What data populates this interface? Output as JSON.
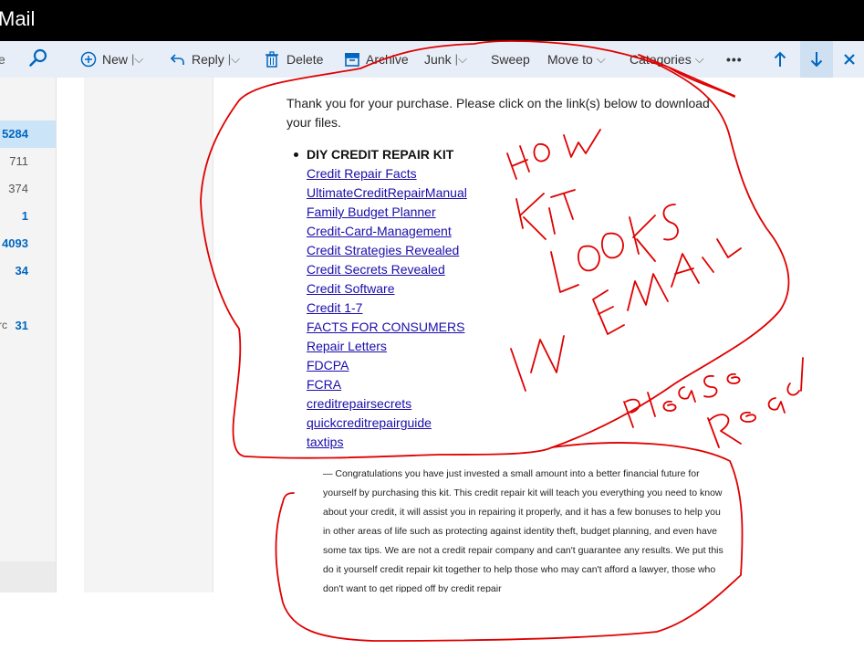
{
  "app": {
    "title": "Mail"
  },
  "search": {
    "cut_label": "e"
  },
  "folders": {
    "counts": [
      {
        "value": "5284",
        "selected": true
      },
      {
        "value": "711"
      },
      {
        "value": "374"
      },
      {
        "value": "1"
      },
      {
        "value": "4093"
      },
      {
        "value": "34"
      },
      {
        "value": "31",
        "cut_label": "rc"
      }
    ]
  },
  "toolbar": {
    "new": "New",
    "reply": "Reply",
    "delete": "Delete",
    "archive": "Archive",
    "junk": "Junk",
    "sweep": "Sweep",
    "move_to": "Move to",
    "categories": "Categories",
    "more": "•••"
  },
  "message": {
    "intro": "Thank you for your purchase. Please click on the link(s) below to download your files.",
    "kit_title": "DIY CREDIT REPAIR KIT",
    "links": [
      "Credit Repair Facts",
      "UltimateCreditRepairManual",
      "Family Budget Planner",
      "Credit-Card-Management",
      "Credit Strategies Revealed",
      "Credit Secrets Revealed",
      "Credit Software",
      "Credit 1-7",
      "FACTS FOR CONSUMERS",
      "Repair Letters",
      "FDCPA",
      "FCRA",
      "creditrepairsecrets",
      "quickcreditrepairguide",
      "taxtips"
    ],
    "paragraph": "— Congratulations you have just invested a small amount into a better financial future for yourself by purchasing this kit. This credit repair kit will teach you everything you need to know about your credit, it will assist you in repairing it properly, and it has a few bonuses to help you in other areas of life such as protecting against identity theft, budget planning, and even have some tax tips. We are not a credit repair company and can't guarantee any results. We put this do it yourself credit repair kit together to help those who may can't afford a lawyer, those who don't want to get ripped off by credit repair"
  },
  "annotations": {
    "words": [
      "HOW",
      "KIT",
      "LOOKS",
      "IN",
      "EMAIL",
      "Please",
      "Read"
    ],
    "ink_color": "#e00000"
  },
  "colors": {
    "accent": "#0067c0",
    "link": "#1a0dab",
    "toolbar_bg": "#e8eef7",
    "selected_bg": "#cce4f7"
  }
}
